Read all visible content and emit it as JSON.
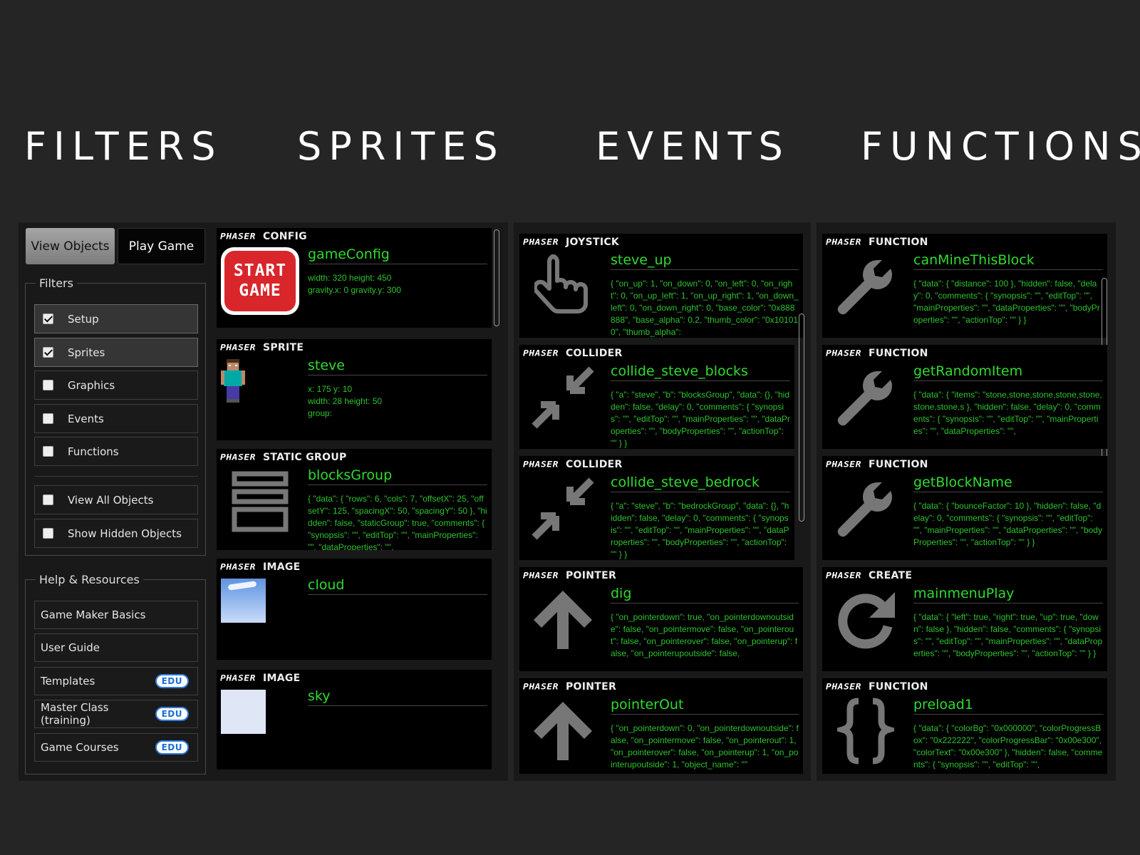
{
  "headings": {
    "filters": "FILTERS",
    "sprites": "SPRITES",
    "events": "EVENTS",
    "functions": "FUNCTIONS"
  },
  "filters_panel": {
    "view_objects": "View Objects",
    "play_game": "Play Game",
    "filters_legend": "Filters",
    "items": [
      {
        "label": "Setup",
        "checked": true
      },
      {
        "label": "Sprites",
        "checked": true
      },
      {
        "label": "Graphics",
        "checked": false
      },
      {
        "label": "Events",
        "checked": false
      },
      {
        "label": "Functions",
        "checked": false
      }
    ],
    "extra": [
      {
        "label": "View All Objects",
        "checked": false
      },
      {
        "label": "Show Hidden Objects",
        "checked": false
      }
    ],
    "help_legend": "Help & Resources",
    "help_items": [
      {
        "label": "Game Maker Basics",
        "badge": ""
      },
      {
        "label": "User Guide",
        "badge": ""
      },
      {
        "label": "Templates",
        "badge": "EDU"
      },
      {
        "label": "Master Class (training)",
        "badge": "EDU"
      },
      {
        "label": "Game Courses",
        "badge": "EDU"
      }
    ]
  },
  "logo_text": "PHASER",
  "sprites": [
    {
      "type": "CONFIG",
      "title": "gameConfig",
      "icon": "start-game-icon",
      "icon_text": [
        "START",
        "GAME"
      ],
      "text": "width: 320 height: 450\ngravity.x: 0 gravity.y: 300"
    },
    {
      "type": "SPRITE",
      "title": "steve",
      "icon": "steve-sprite-icon",
      "text": "x: 175 y: 10\nwidth: 28 height: 50\ngroup:"
    },
    {
      "type": "STATIC GROUP",
      "title": "blocksGroup",
      "icon": "blocks-group-icon",
      "text": "{ \"data\": { \"rows\": 6, \"cols\": 7, \"offsetX\": 25, \"offsetY\": 125, \"spacingX\": 50, \"spacingY\": 50 }, \"hidden\": false, \"staticGroup\": true, \"comments\": { \"synopsis\": \"\", \"editTop\": \"\", \"mainProperties\": \"\", \"dataProperties\": \"\","
    },
    {
      "type": "IMAGE",
      "title": "cloud",
      "icon": "cloud-image-icon",
      "text": ""
    },
    {
      "type": "IMAGE",
      "title": "sky",
      "icon": "sky-image-icon",
      "text": ""
    }
  ],
  "events": [
    {
      "type": "JOYSTICK",
      "title": "steve_up",
      "icon": "hand-pointer-icon",
      "text": "{ \"on_up\": 1, \"on_down\": 0, \"on_left\": 0, \"on_right\": 0, \"on_up_left\": 1, \"on_up_right\": 1, \"on_down_left\": 0, \"on_down_right\": 0, \"base_color\": \"0x888888\", \"base_alpha\": 0.2, \"thumb_color\": \"0x101010\", \"thumb_alpha\":"
    },
    {
      "type": "COLLIDER",
      "title": "collide_steve_blocks",
      "icon": "collide-arrows-icon",
      "text": "{ \"a\": \"steve\", \"b\": \"blocksGroup\", \"data\": {}, \"hidden\": false, \"delay\": 0, \"comments\": { \"synopsis\": \"\", \"editTop\": \"\", \"mainProperties\": \"\", \"dataProperties\": \"\", \"bodyProperties\": \"\", \"actionTop\": \"\" } }"
    },
    {
      "type": "COLLIDER",
      "title": "collide_steve_bedrock",
      "icon": "collide-arrows-icon",
      "text": "{ \"a\": \"steve\", \"b\": \"bedrockGroup\", \"data\": {}, \"hidden\": false, \"delay\": 0, \"comments\": { \"synopsis\": \"\", \"editTop\": \"\", \"mainProperties\": \"\", \"dataProperties\": \"\", \"bodyProperties\": \"\", \"actionTop\": \"\" } }"
    },
    {
      "type": "POINTER",
      "title": "dig",
      "icon": "arrow-up-icon",
      "text": "{ \"on_pointerdown\": true, \"on_pointerdownoutside\": false, \"on_pointermove\": false, \"on_pointerout\": false, \"on_pointerover\": false, \"on_pointerup\": false, \"on_pointerupoutside\": false,"
    },
    {
      "type": "POINTER",
      "title": "pointerOut",
      "icon": "arrow-up-icon",
      "text": "{ \"on_pointerdown\": 0, \"on_pointerdownoutside\": false, \"on_pointermove\": false, \"on_pointerout\": 1, \"on_pointerover\": false, \"on_pointerup\": 1, \"on_pointerupoutside\": 1, \"object_name\": \"\""
    }
  ],
  "functions": [
    {
      "type": "FUNCTION",
      "title": "canMineThisBlock",
      "icon": "wrench-icon",
      "text": "{ \"data\": { \"distance\": 100 }, \"hidden\": false, \"delay\": 0, \"comments\": { \"synopsis\": \"\", \"editTop\": \"\", \"mainProperties\": \"\", \"dataProperties\": \"\", \"bodyProperties\": \"\", \"actionTop\": \"\" } }"
    },
    {
      "type": "FUNCTION",
      "title": "getRandomItem",
      "icon": "wrench-icon",
      "text": "{ \"data\": { \"items\": \"stone,stone,stone,stone,stone,stone,stone,s }, \"hidden\": false, \"delay\": 0, \"comments\": { \"synopsis\": \"\", \"editTop\": \"\", \"mainProperties\": \"\", \"dataProperties\": \"\","
    },
    {
      "type": "FUNCTION",
      "title": "getBlockName",
      "icon": "wrench-icon",
      "text": "{ \"data\": { \"bounceFactor\": 10 }, \"hidden\": false, \"delay\": 0, \"comments\": { \"synopsis\": \"\", \"editTop\": \"\", \"mainProperties\": \"\", \"dataProperties\": \"\", \"bodyProperties\": \"\", \"actionTop\": \"\" } }"
    },
    {
      "type": "CREATE",
      "title": "mainmenuPlay",
      "icon": "refresh-icon",
      "text": "{ \"data\": { \"left\": true, \"right\": true, \"up\": true, \"down\": false }, \"hidden\": false, \"comments\": { \"synopsis\": \"\", \"editTop\": \"\", \"mainProperties\": \"\", \"dataProperties\": \"\", \"bodyProperties\": \"\", \"actionTop\": \"\" } }"
    },
    {
      "type": "FUNCTION",
      "title": "preload1",
      "icon": "curly-braces-icon",
      "text": "{ \"data\": { \"colorBg\": \"0x000000\", \"colorProgressBox\": \"0x222222\", \"colorProgressBar\": \"0x00e300\", \"colorText\": \"0x00e300\" }, \"hidden\": false, \"comments\": { \"synopsis\": \"\", \"editTop\": \"\","
    }
  ]
}
